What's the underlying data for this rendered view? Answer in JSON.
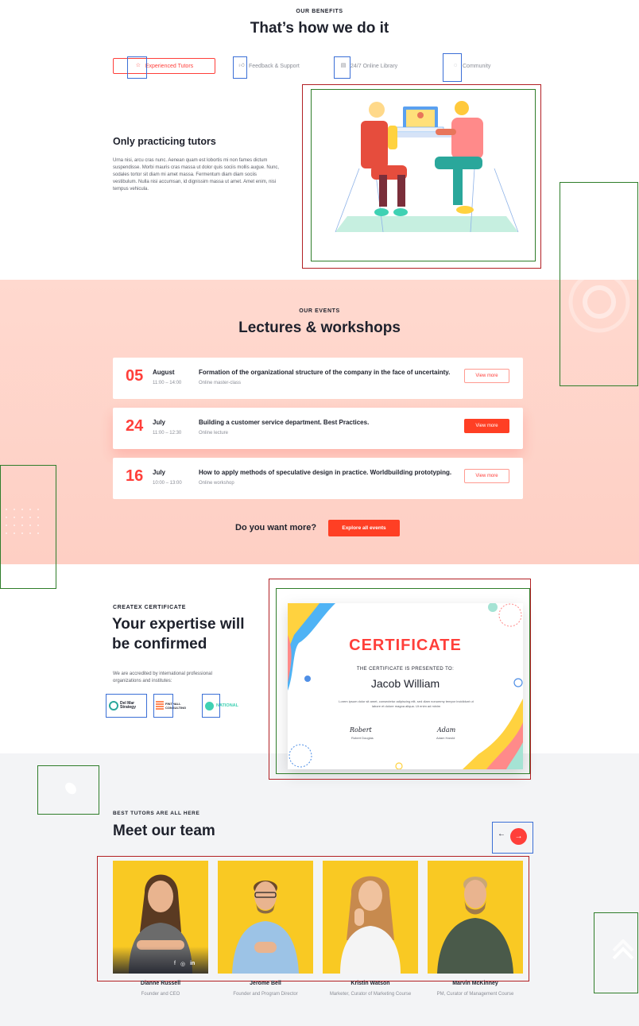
{
  "benefits": {
    "eyebrow": "OUR BENEFITS",
    "title": "That’s how we do it",
    "tabs": [
      {
        "label": "Experienced Tutors",
        "icon": "star-icon"
      },
      {
        "label": "Feedback & Support",
        "icon": "thumbs-up-icon"
      },
      {
        "label": "24/7 Online Library",
        "icon": "library-icon"
      },
      {
        "label": "Community",
        "icon": "chat-icon"
      }
    ],
    "panel_title": "Only practicing tutors",
    "panel_text": "Urna nisi, arcu cras nunc. Aenean quam est lobortis mi non fames dictum suspendisse. Morbi mauris cras massa ut dolor quis sociis mollis augue. Nunc, sodales tortor sit diam mi amet massa. Fermentum diam diam sociis vestibulum. Nulla nisi accumsan, id dignissim massa ut amet. Amet enim, nisi tempus vehicula."
  },
  "events": {
    "eyebrow": "OUR EVENTS",
    "title": "Lectures & workshops",
    "items": [
      {
        "day": "05",
        "month": "August",
        "time": "11:00 – 14:00",
        "title": "Formation of the organizational structure of the company in the face of uncertainty.",
        "type": "Online master-class",
        "button": "View more"
      },
      {
        "day": "24",
        "month": "July",
        "time": "11:00 – 12:30",
        "title": "Building a customer service department. Best Practices.",
        "type": "Online lecture",
        "button": "View more"
      },
      {
        "day": "16",
        "month": "July",
        "time": "10:00 – 13:00",
        "title": "How to apply methods of speculative design in practice. Worldbuilding prototyping.",
        "type": "Online workshop",
        "button": "View more"
      }
    ],
    "more_text": "Do you want more?",
    "explore_button": "Explore all events"
  },
  "certificate": {
    "eyebrow": "CREATEX CERTIFICATE",
    "title_line1": "Your expertise will",
    "title_line2": "be confirmed",
    "text": "We are accredited by international professional organizations and institutes:",
    "partners": [
      {
        "name": "Del Mar Strategy",
        "icon": "del-mar-logo-icon"
      },
      {
        "name": "FINTHALL CONSULTING",
        "icon": "consulting-logo-icon"
      },
      {
        "name": "NATIONAL",
        "icon": "national-logo-icon"
      }
    ],
    "card": {
      "heading": "CERTIFICATE",
      "presented": "THE CERTIFICATE IS PRESENTED TO:",
      "recipient": "Jacob William",
      "body": "Lorem ipsum dolor sit amet, consectetur adipiscing elit, sed diam nonummy tempor incididunt ut labore et dolore magna aliqua. Ut enim ad minim",
      "sign1_script": "Robert",
      "sign1_name": "Robert Douglas",
      "sign2_script": "Adam",
      "sign2_name": "Adam Harold"
    }
  },
  "team": {
    "eyebrow": "BEST TUTORS ARE ALL HERE",
    "title": "Meet our team",
    "prev": "←",
    "next": "→",
    "members": [
      {
        "name": "Dianne Russell",
        "role": "Founder and CEO"
      },
      {
        "name": "Jerome Bell",
        "role": "Founder and Program Director"
      },
      {
        "name": "Kristin Watson",
        "role": "Marketer, Curator of Marketing Course"
      },
      {
        "name": "Marvin McKinney",
        "role": "PM, Curator of Management Course"
      }
    ],
    "social": [
      "f",
      "◎",
      "in"
    ]
  },
  "colors": {
    "accent": "#ff3f3a",
    "peach": "#fecfc4",
    "yellow": "#f9c923",
    "dark": "#1e212c"
  }
}
